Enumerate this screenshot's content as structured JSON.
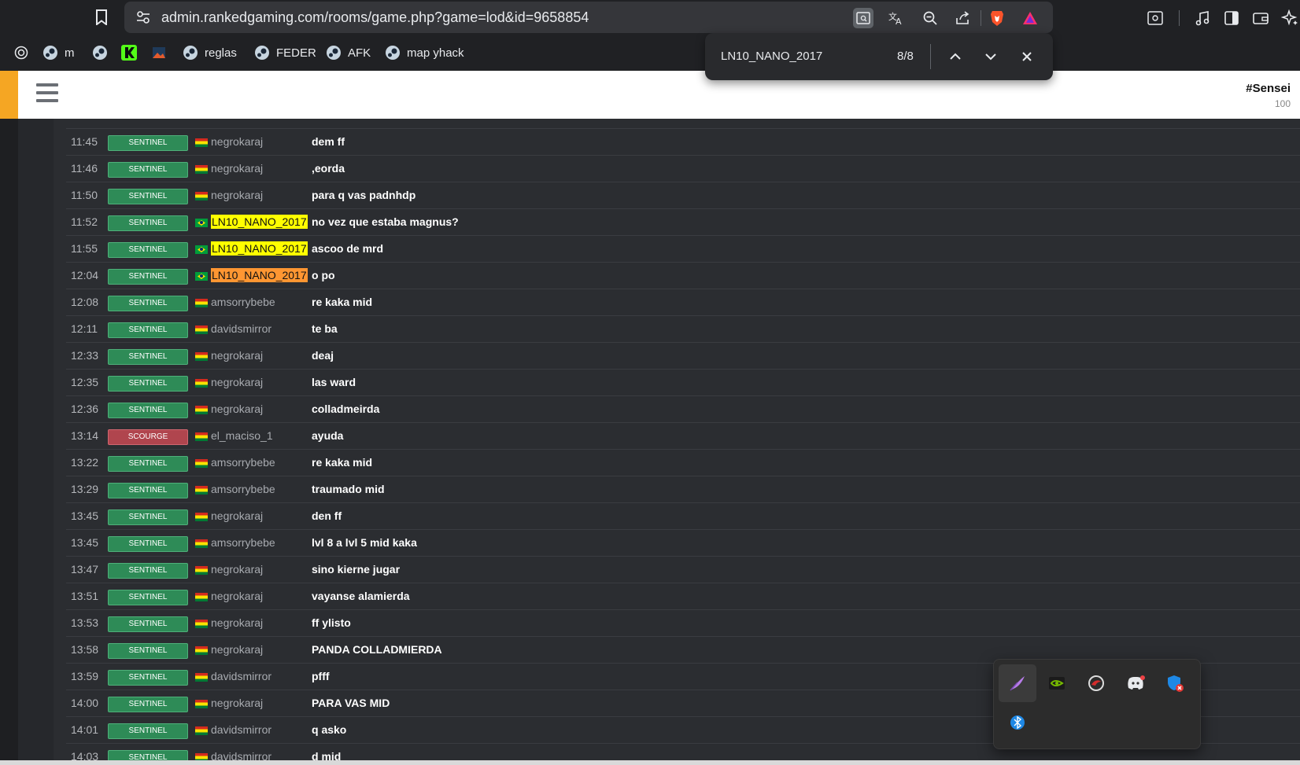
{
  "browser": {
    "url": "admin.rankedgaming.com/rooms/game.php?game=lod&id=9658854",
    "bookmarks": [
      {
        "label": "",
        "icon": "chatgpt-icon"
      },
      {
        "label": "m",
        "icon": "steam-icon"
      },
      {
        "label": "",
        "icon": "steam-icon"
      },
      {
        "label": "",
        "icon": "k-logo-icon"
      },
      {
        "label": "",
        "icon": "gallery-icon"
      },
      {
        "label": "reglas",
        "icon": "steam-icon"
      },
      {
        "label": "FEDER",
        "icon": "steam-icon"
      },
      {
        "label": "AFK",
        "icon": "steam-icon"
      },
      {
        "label": "map yhack",
        "icon": "steam-icon"
      }
    ]
  },
  "find": {
    "query": "LN10_NANO_2017",
    "count": "8/8"
  },
  "header": {
    "profile_name": "#Sensei",
    "profile_sub": "100"
  },
  "chat": {
    "rows": [
      {
        "time": "11:45",
        "team": "SENTINEL",
        "flag": "bo",
        "player": "negrokaraj",
        "highlight": "",
        "message": "dem ff"
      },
      {
        "time": "11:46",
        "team": "SENTINEL",
        "flag": "bo",
        "player": "negrokaraj",
        "highlight": "",
        "message": ",eorda"
      },
      {
        "time": "11:50",
        "team": "SENTINEL",
        "flag": "bo",
        "player": "negrokaraj",
        "highlight": "",
        "message": "para q vas padnhdp"
      },
      {
        "time": "11:52",
        "team": "SENTINEL",
        "flag": "br",
        "player": "LN10_NANO_2017",
        "highlight": "match",
        "message": "no vez que estaba magnus?"
      },
      {
        "time": "11:55",
        "team": "SENTINEL",
        "flag": "br",
        "player": "LN10_NANO_2017",
        "highlight": "match",
        "message": "ascoo de mrd"
      },
      {
        "time": "12:04",
        "team": "SENTINEL",
        "flag": "br",
        "player": "LN10_NANO_2017",
        "highlight": "current",
        "message": "o po"
      },
      {
        "time": "12:08",
        "team": "SENTINEL",
        "flag": "bo",
        "player": "amsorrybebe",
        "highlight": "",
        "message": "re kaka mid"
      },
      {
        "time": "12:11",
        "team": "SENTINEL",
        "flag": "bo",
        "player": "davidsmirror",
        "highlight": "",
        "message": "te ba"
      },
      {
        "time": "12:33",
        "team": "SENTINEL",
        "flag": "bo",
        "player": "negrokaraj",
        "highlight": "",
        "message": "deaj"
      },
      {
        "time": "12:35",
        "team": "SENTINEL",
        "flag": "bo",
        "player": "negrokaraj",
        "highlight": "",
        "message": "las ward"
      },
      {
        "time": "12:36",
        "team": "SENTINEL",
        "flag": "bo",
        "player": "negrokaraj",
        "highlight": "",
        "message": "colladmeirda"
      },
      {
        "time": "13:14",
        "team": "SCOURGE",
        "flag": "bo",
        "player": "el_maciso_1",
        "highlight": "",
        "message": "ayuda"
      },
      {
        "time": "13:22",
        "team": "SENTINEL",
        "flag": "bo",
        "player": "amsorrybebe",
        "highlight": "",
        "message": "re kaka mid"
      },
      {
        "time": "13:29",
        "team": "SENTINEL",
        "flag": "bo",
        "player": "amsorrybebe",
        "highlight": "",
        "message": "traumado mid"
      },
      {
        "time": "13:45",
        "team": "SENTINEL",
        "flag": "bo",
        "player": "negrokaraj",
        "highlight": "",
        "message": "den ff"
      },
      {
        "time": "13:45",
        "team": "SENTINEL",
        "flag": "bo",
        "player": "amsorrybebe",
        "highlight": "",
        "message": "lvl 8 a lvl 5 mid kaka"
      },
      {
        "time": "13:47",
        "team": "SENTINEL",
        "flag": "bo",
        "player": "negrokaraj",
        "highlight": "",
        "message": "sino kierne jugar"
      },
      {
        "time": "13:51",
        "team": "SENTINEL",
        "flag": "bo",
        "player": "negrokaraj",
        "highlight": "",
        "message": "vayanse alamierda"
      },
      {
        "time": "13:53",
        "team": "SENTINEL",
        "flag": "bo",
        "player": "negrokaraj",
        "highlight": "",
        "message": "ff ylisto"
      },
      {
        "time": "13:58",
        "team": "SENTINEL",
        "flag": "bo",
        "player": "negrokaraj",
        "highlight": "",
        "message": "PANDA COLLADMIERDA"
      },
      {
        "time": "13:59",
        "team": "SENTINEL",
        "flag": "bo",
        "player": "davidsmirror",
        "highlight": "",
        "message": "pfff"
      },
      {
        "time": "14:00",
        "team": "SENTINEL",
        "flag": "bo",
        "player": "negrokaraj",
        "highlight": "",
        "message": "PARA VAS MID"
      },
      {
        "time": "14:01",
        "team": "SENTINEL",
        "flag": "bo",
        "player": "davidsmirror",
        "highlight": "",
        "message": "q asko"
      },
      {
        "time": "14:03",
        "team": "SENTINEL",
        "flag": "bo",
        "player": "davidsmirror",
        "highlight": "",
        "message": "d mid"
      }
    ]
  },
  "tray": {
    "icons": [
      "feather-app-icon",
      "nvidia-icon",
      "rog-armoury-icon",
      "discord-icon",
      "windows-security-icon",
      "bluetooth-icon"
    ]
  },
  "colors": {
    "sentinel": "#2e8b57",
    "scourge": "#b0454e",
    "find_match": "#ffff00",
    "find_current": "#ff9632",
    "header_accent": "#f5a623"
  }
}
